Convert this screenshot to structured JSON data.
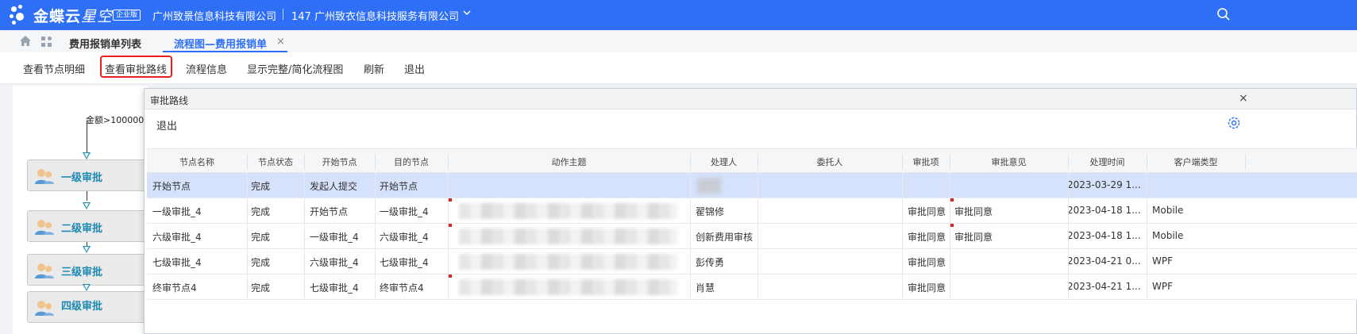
{
  "topbar": {
    "brand": "金蝶云",
    "brand_italic": "星空",
    "badge": "企业版",
    "org1": "广州致景信息科技有限公司",
    "org2": "147 广州致衣信息科技服务有限公司",
    "color": "#2f6ff5"
  },
  "tabs": [
    {
      "label": "费用报销单列表"
    },
    {
      "label": "流程图—费用报销单"
    }
  ],
  "toolbar": {
    "items": [
      "查看节点明细",
      "查看审批路线",
      "流程信息",
      "显示完整/简化流程图",
      "刷新",
      "退出"
    ],
    "highlighted": "查看审批路线",
    "highlight_color": "#e62020"
  },
  "flow": {
    "condition": "金额>100000",
    "nodes": [
      "一级审批",
      "二级审批",
      "三级审批",
      "四级审批"
    ]
  },
  "dialog": {
    "title": "审批路线",
    "exit": "退出",
    "columns": [
      "节点名称",
      "节点状态",
      "开始节点",
      "目的节点",
      "动作主题",
      "处理人",
      "委托人",
      "审批项",
      "审批意见",
      "处理时间",
      "客户端类型"
    ],
    "rows": [
      [
        "开始节点",
        "完成",
        "发起人提交",
        "开始节点",
        "",
        "",
        "",
        "",
        "",
        "2023-03-29 1...",
        ""
      ],
      [
        "一级审批_4",
        "完成",
        "开始节点",
        "一级审批_4",
        "",
        "翟锦修",
        "",
        "审批同意",
        "审批同意",
        "2023-04-18 1...",
        "Mobile"
      ],
      [
        "六级审批_4",
        "完成",
        "一级审批_4",
        "六级审批_4",
        "",
        "创新费用审核",
        "",
        "审批同意",
        "审批同意",
        "2023-04-18 1...",
        "Mobile"
      ],
      [
        "七级审批_4",
        "完成",
        "六级审批_4",
        "七级审批_4",
        "",
        "彭传勇",
        "",
        "审批同意",
        "",
        "2023-04-21 0...",
        "WPF"
      ],
      [
        "终审节点4",
        "完成",
        "七级审批_4",
        "终审节点4",
        "",
        "肖慧",
        "",
        "审批同意",
        "",
        "2023-04-21 1...",
        "WPF"
      ]
    ],
    "selected_row": 0
  }
}
